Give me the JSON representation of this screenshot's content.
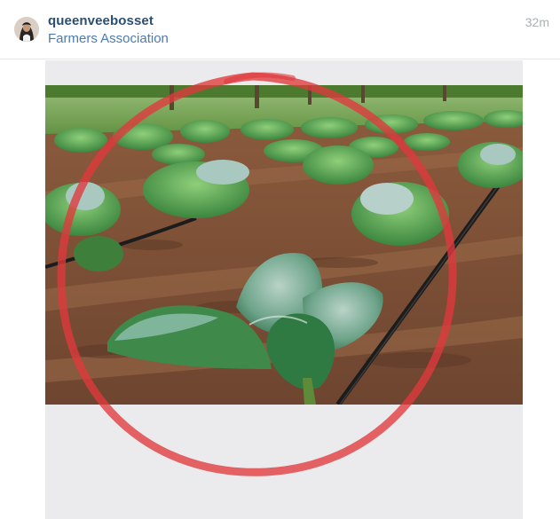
{
  "post": {
    "username": "queenveebosset",
    "location": "Farmers Association",
    "timestamp": "32m"
  },
  "media": {
    "subject": "cabbage-seedlings-with-drip-irrigation",
    "annotation_color": "#e0383c"
  },
  "colors": {
    "username": "#2b4f73",
    "location": "#4a7bb0",
    "timestamp": "#a8b0b8",
    "frame_background": "#ebeaec"
  }
}
